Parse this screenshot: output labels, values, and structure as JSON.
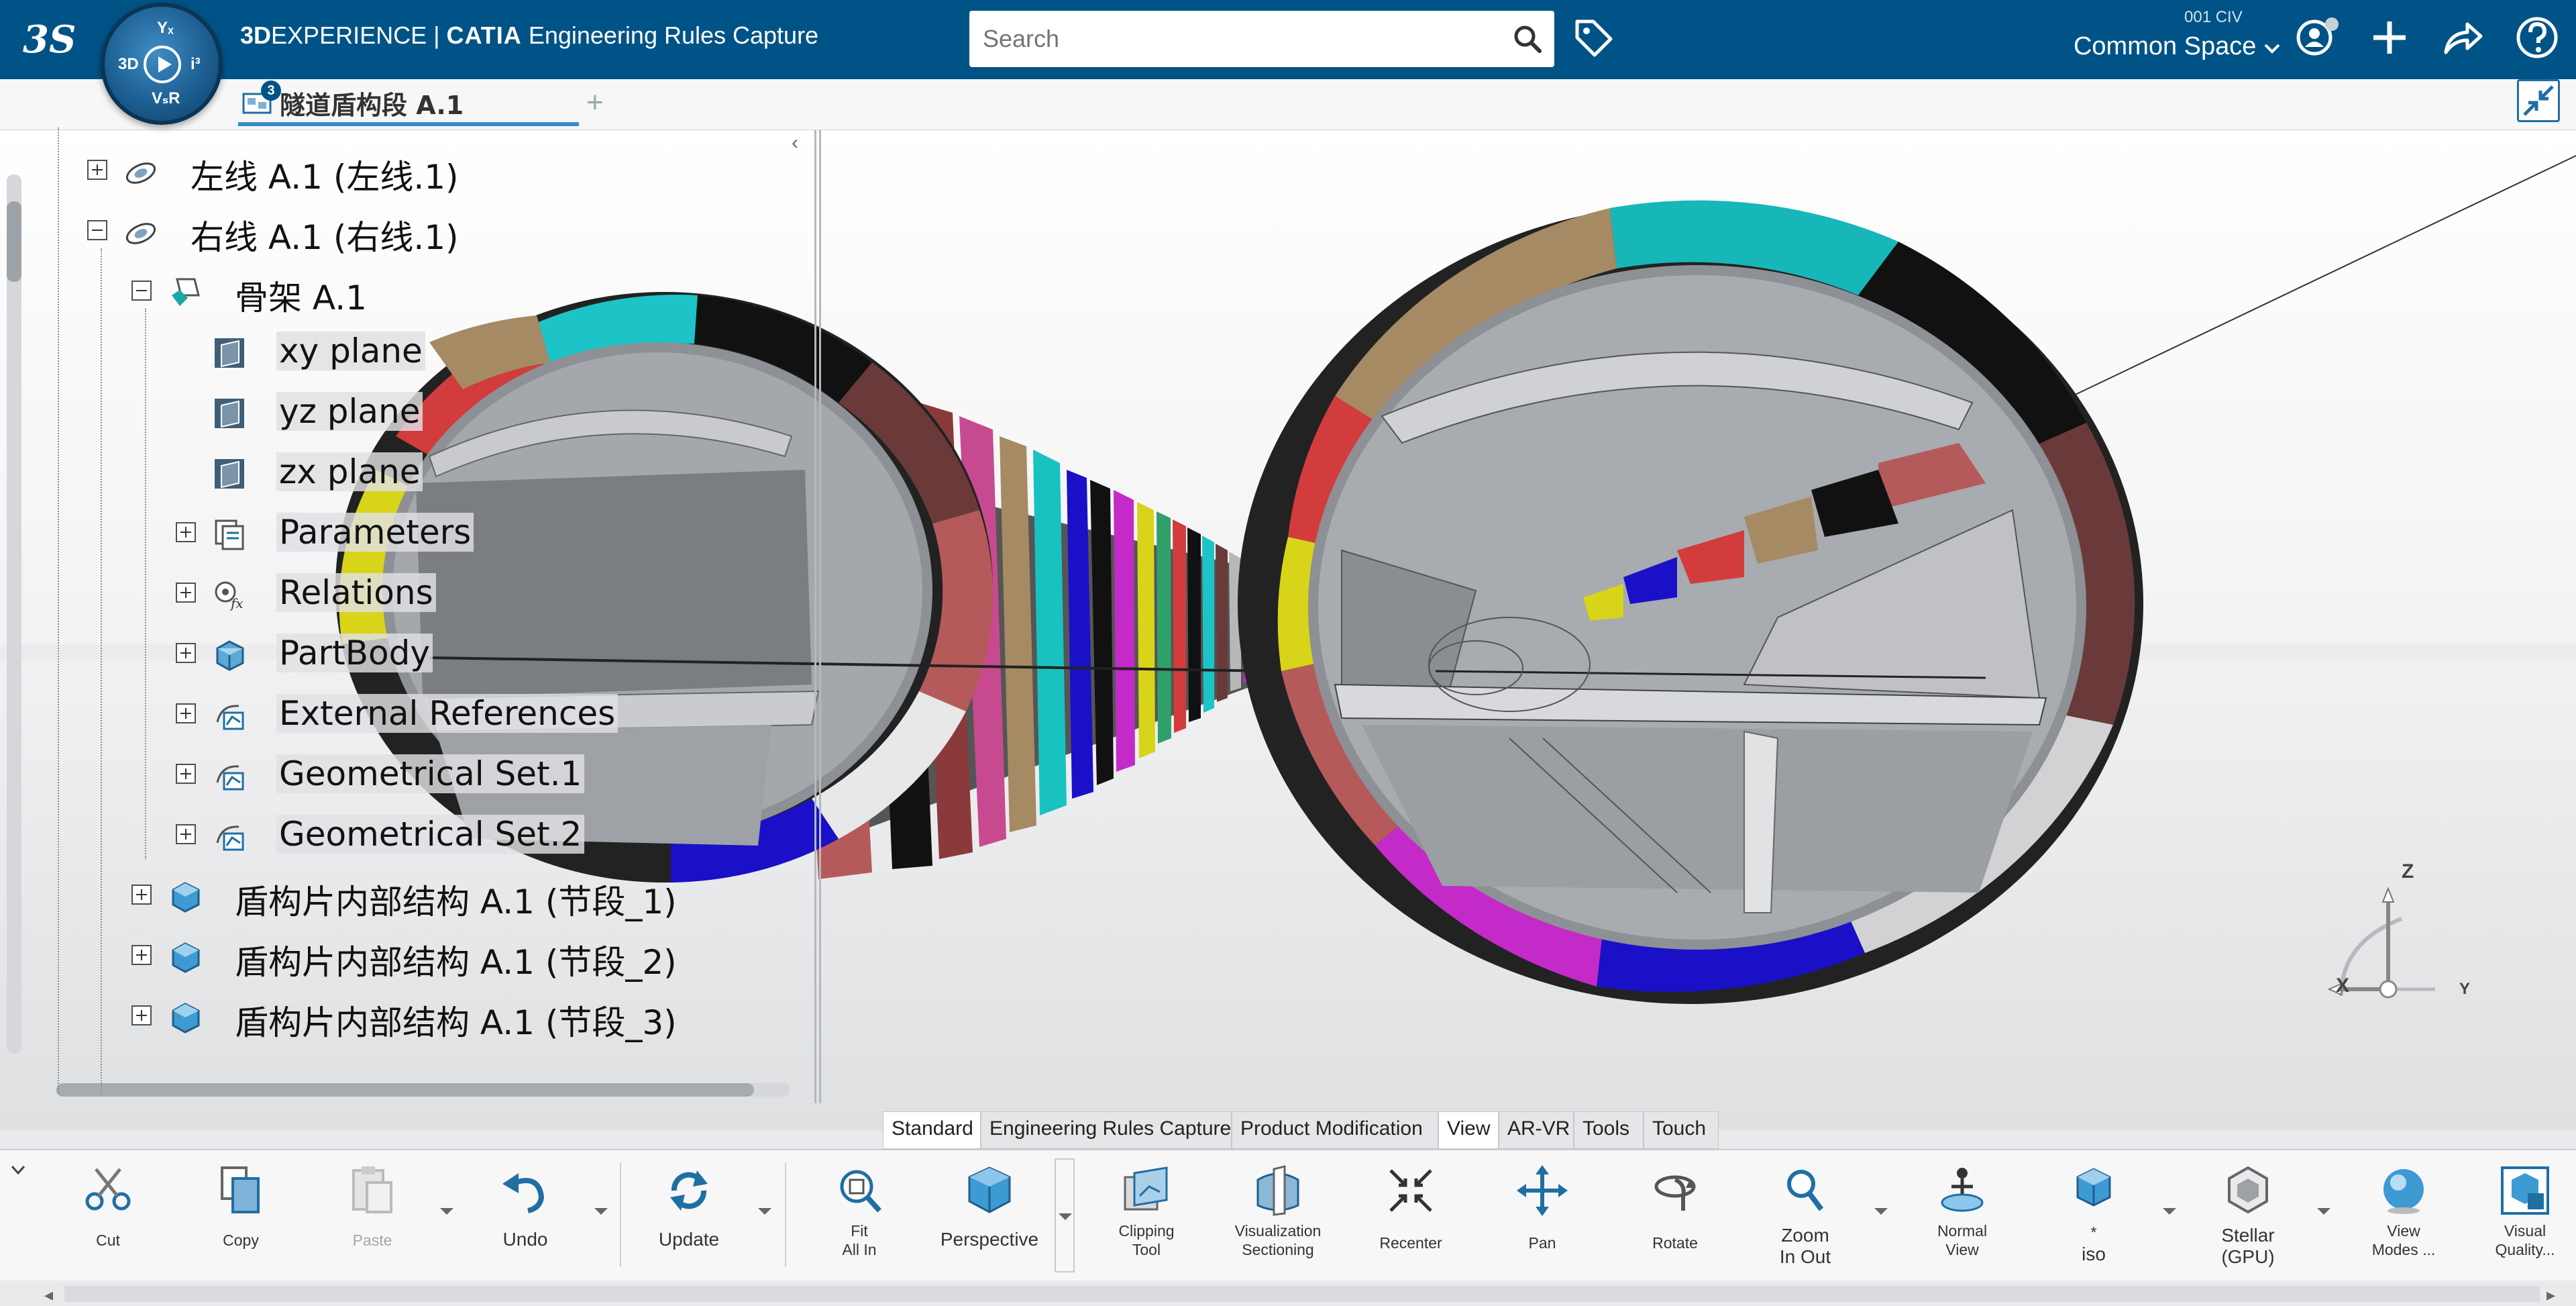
{
  "header": {
    "brand_prefix": "3D",
    "brand_suffix": "EXPERIENCE",
    "separator": "|",
    "app_name": "CATIA",
    "app_module": "Engineering Rules Capture",
    "search_placeholder": "Search",
    "space_code": "001 CIV",
    "space_name": "Common Space",
    "compass": {
      "quadrant_top": "Yₓ",
      "quadrant_left": "3D",
      "quadrant_right": "i³",
      "quadrant_bottom": "VₛR"
    }
  },
  "document_tab": {
    "label": "隧道盾构段 A.1",
    "badge": "3",
    "add_label": "+"
  },
  "tree": {
    "collapse_arrow": "‹",
    "nodes": [
      {
        "label": "左线 A.1 (左线.1)",
        "expand": "plus",
        "icon": "product-icon"
      },
      {
        "label": "右线 A.1 (右线.1)",
        "expand": "minus",
        "icon": "product-icon"
      },
      {
        "label": "骨架 A.1",
        "expand": "minus",
        "icon": "part-icon"
      },
      {
        "label": "xy plane",
        "expand": "none",
        "icon": "plane-icon"
      },
      {
        "label": "yz plane",
        "expand": "none",
        "icon": "plane-icon"
      },
      {
        "label": "zx plane",
        "expand": "none",
        "icon": "plane-icon"
      },
      {
        "label": "Parameters",
        "expand": "plus",
        "icon": "parameters-icon"
      },
      {
        "label": "Relations",
        "expand": "plus",
        "icon": "relations-icon"
      },
      {
        "label": "PartBody",
        "expand": "plus",
        "icon": "partbody-icon"
      },
      {
        "label": "External References",
        "expand": "plus",
        "icon": "geometrical-set-icon"
      },
      {
        "label": "Geometrical Set.1",
        "expand": "plus",
        "icon": "geometrical-set-icon"
      },
      {
        "label": "Geometrical Set.2",
        "expand": "plus",
        "icon": "geometrical-set-icon"
      },
      {
        "label": "盾构片内部结构 A.1 (节段_1)",
        "expand": "plus",
        "icon": "product-cube-icon"
      },
      {
        "label": "盾构片内部结构 A.1 (节段_2)",
        "expand": "plus",
        "icon": "product-cube-icon"
      },
      {
        "label": "盾构片内部结构 A.1 (节段_3)",
        "expand": "plus",
        "icon": "product-cube-icon"
      }
    ]
  },
  "command_tabs": [
    {
      "label": "Standard",
      "active": true
    },
    {
      "label": "Engineering Rules Capture",
      "active": false
    },
    {
      "label": "Product Modification",
      "active": false
    },
    {
      "label": "View",
      "active": true
    },
    {
      "label": "AR-VR",
      "active": false
    },
    {
      "label": "Tools",
      "active": false
    },
    {
      "label": "Touch",
      "active": false
    }
  ],
  "toolbar": {
    "cut": "Cut",
    "copy": "Copy",
    "paste": "Paste",
    "undo": "Undo",
    "update": "Update",
    "fit_all_1": "Fit",
    "fit_all_2": "All In",
    "perspective": "Perspective",
    "clipping_1": "Clipping",
    "clipping_2": "Tool",
    "visualization_1": "Visualization",
    "visualization_2": "Sectioning",
    "recenter": "Recenter",
    "pan": "Pan",
    "rotate": "Rotate",
    "zoom_1": "Zoom",
    "zoom_2": "In Out",
    "normal_1": "Normal",
    "normal_2": "View",
    "iso_1": "*",
    "iso_2": "iso",
    "stellar_1": "Stellar",
    "stellar_2": "(GPU)",
    "view_modes_1": "View",
    "view_modes_2": "Modes ...",
    "visual_quality_1": "Visual",
    "visual_quality_2": "Quality..."
  },
  "compass_axes": {
    "z": "Z",
    "x": "X",
    "y": "Y"
  },
  "colors": {
    "header_bg": "#005386",
    "tab_underline": "#368ec4",
    "ring_red": "#d23c3c",
    "ring_cyan": "#1cc4c8",
    "ring_magenta": "#c42ac8",
    "ring_blue": "#1a10c8",
    "ring_yellow": "#d8d41a",
    "ring_maroon": "#6a3a3a",
    "ring_tan": "#a58a64"
  }
}
